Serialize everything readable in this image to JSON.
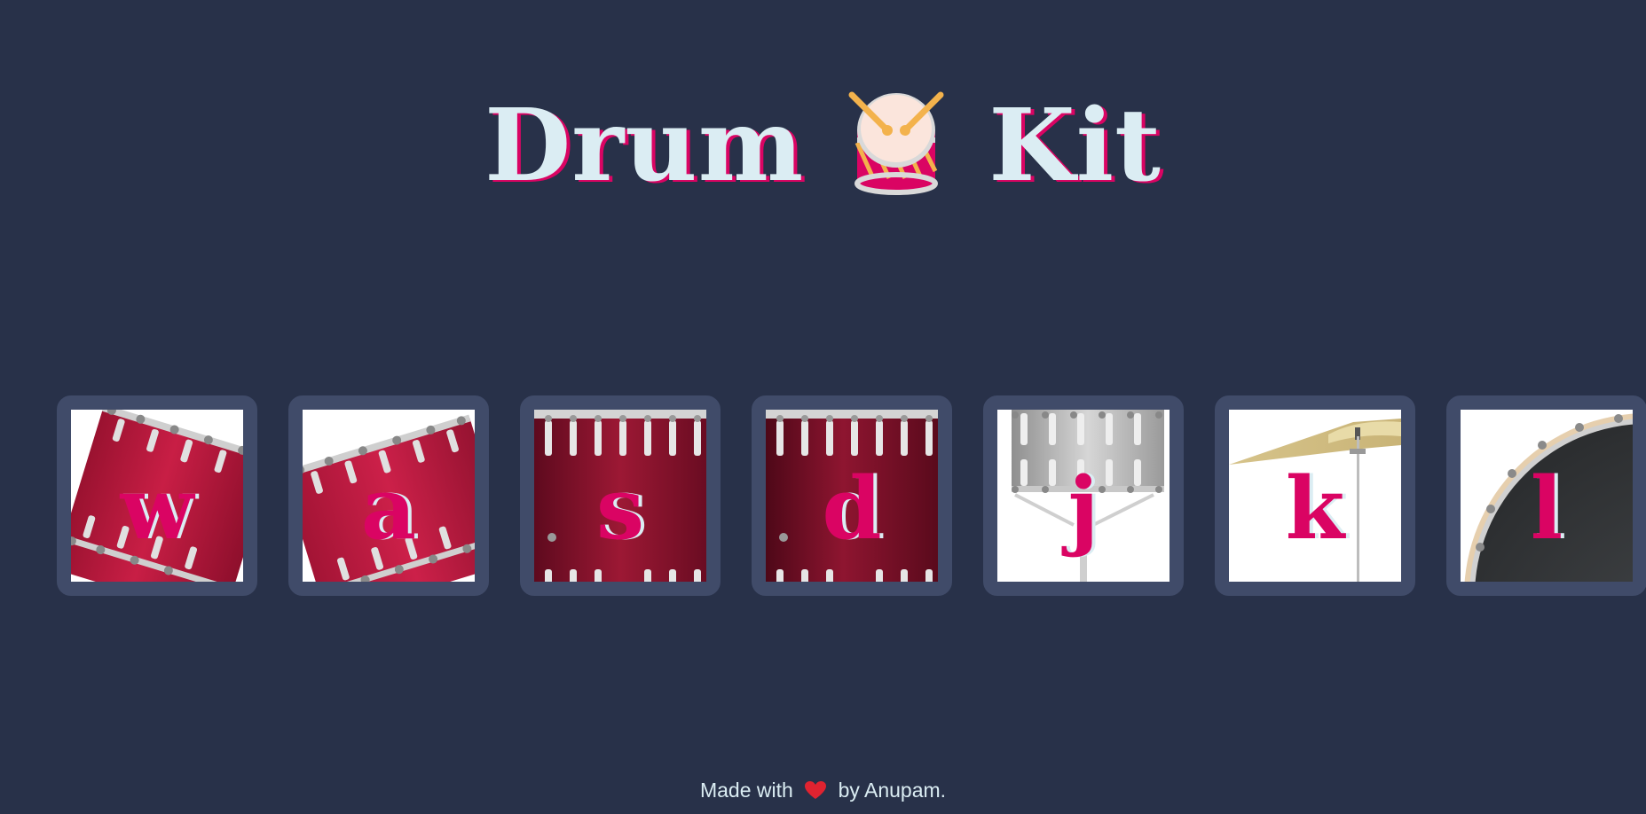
{
  "header": {
    "title_part1": "Drum",
    "title_part2": "Kit",
    "title_icon": "drum-icon"
  },
  "drums": [
    {
      "key": "w",
      "instrument_icon": "tom-drum-icon"
    },
    {
      "key": "a",
      "instrument_icon": "tom-drum-icon"
    },
    {
      "key": "s",
      "instrument_icon": "floor-tom-icon"
    },
    {
      "key": "d",
      "instrument_icon": "floor-tom-icon"
    },
    {
      "key": "j",
      "instrument_icon": "snare-drum-icon"
    },
    {
      "key": "k",
      "instrument_icon": "cymbal-icon"
    },
    {
      "key": "l",
      "instrument_icon": "bass-drum-icon"
    }
  ],
  "footer": {
    "made_with": "Made with",
    "heart_icon": "heart-icon",
    "by": "by Anupam."
  },
  "colors": {
    "background": "#283149",
    "tile_border": "#404B69",
    "accent": "#DA0463",
    "light": "#DBEDF3"
  }
}
